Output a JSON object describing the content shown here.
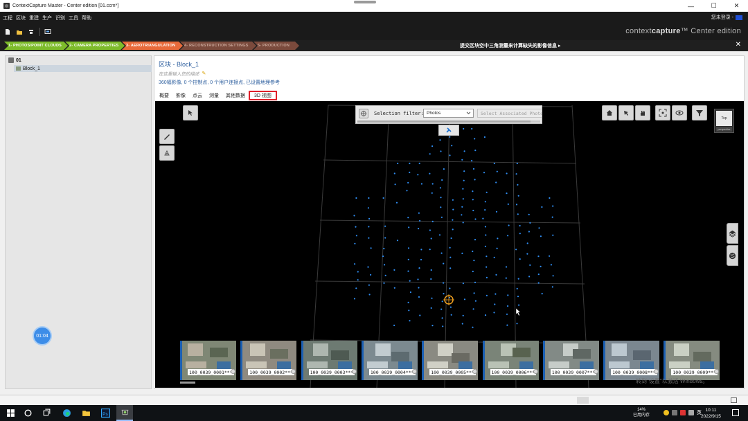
{
  "window": {
    "title": "ContextCapture Master - Center edition [01.ccm*]",
    "controls": {
      "minimize": "—",
      "maximize": "☐",
      "close": "✕"
    }
  },
  "menu": {
    "items": [
      "工程",
      "区块",
      "重建",
      "生产",
      "识别",
      "工具",
      "帮助"
    ],
    "login": "您未登录 -"
  },
  "toolbar": {
    "buttons": [
      "new-file-icon",
      "open-folder-icon",
      "save-icon",
      "screen-icon"
    ],
    "brand_prefix": "context",
    "brand_bold": "capture",
    "brand_suffix": "™  Center edition"
  },
  "workflow": {
    "steps": [
      {
        "label": "1- PHOTOS/POINT CLOUDS",
        "color": "#7dbb2a"
      },
      {
        "label": "2- CAMERA PROPERTIES",
        "color": "#7dbb2a"
      },
      {
        "label": "3- AEROTRIANGULATION",
        "color": "#e86a3a"
      },
      {
        "label": "4- RECONSTRUCTION SETTINGS",
        "color": "#7a4a3c"
      },
      {
        "label": "5- PRODUCTION",
        "color": "#7a4a3c"
      }
    ],
    "message": "提交区块空中三角测量来计算缺失的影像信息 ▸",
    "close": "✕"
  },
  "tree": {
    "root": "01",
    "item": "Block_1"
  },
  "block": {
    "title": "区块 - Block_1",
    "description": "在这里输入您的描述",
    "stats": "360幅影像, 0 个控制点, 0 个用户连接点, 已设置地理参考"
  },
  "tabs": [
    "概要",
    "影像",
    "点云",
    "测量",
    "其他数据",
    "3D 视图"
  ],
  "viewer": {
    "filter_label": "Selection filter:",
    "filter_value": "Photos",
    "select_button": "Select Associated Photos",
    "navcube_face": "Top",
    "navcube_base": "perspective"
  },
  "thumbnails": [
    "100_0039_0001***",
    "100_0039_0002***",
    "100_0039_0003***",
    "100_0039_0004***",
    "100_0039_0005***",
    "100_0039_0006***",
    "100_0039_0007***",
    "100_0039_0008***",
    "100_0039_0009***"
  ],
  "overlay": {
    "timer": "01:04",
    "watermark": "转到\"设置\"以激活 Windows。"
  },
  "taskbar": {
    "memory_pct": "14%",
    "memory_label": "已用内存",
    "ime": "英",
    "time": "10:11",
    "date": "2022/9/15"
  }
}
